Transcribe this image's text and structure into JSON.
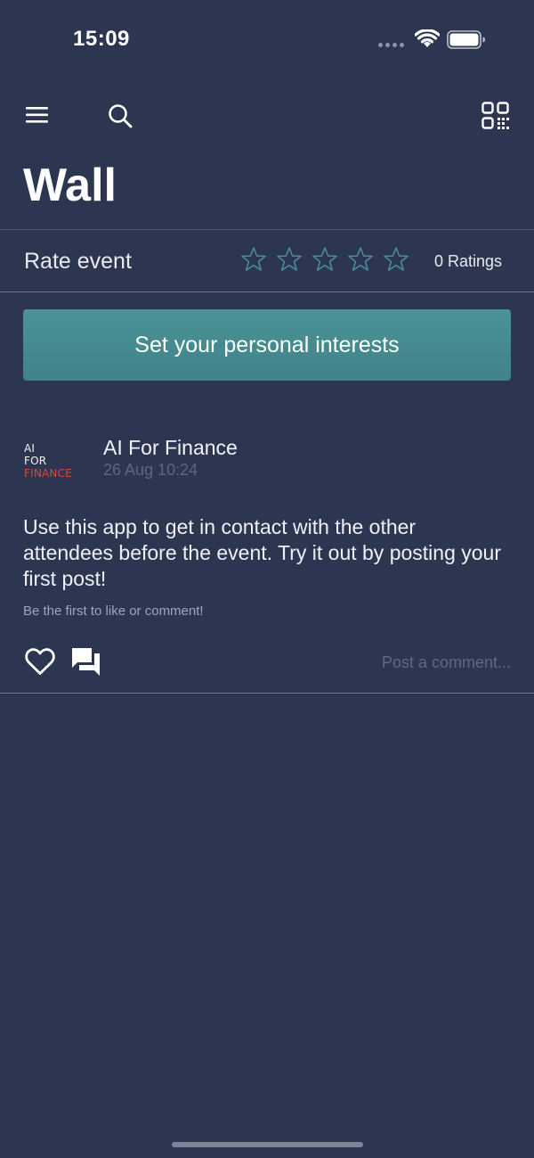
{
  "status_bar": {
    "time": "15:09"
  },
  "toolbar": {
    "menu_icon": "menu-icon",
    "search_icon": "search-icon",
    "qr_icon": "qr-code-icon"
  },
  "page": {
    "title": "Wall"
  },
  "rating": {
    "label": "Rate event",
    "stars_total": 5,
    "stars_filled": 0,
    "count_text": "0 Ratings"
  },
  "interests_button": {
    "label": "Set your personal interests"
  },
  "post": {
    "logo_lines": [
      "AI",
      "FOR",
      "FINANCE"
    ],
    "author": "AI For Finance",
    "timestamp": "26 Aug 10:24",
    "body": "Use this app to get in contact with the other attendees before the event. Try it out by posting your first post!",
    "hint": "Be the first to like or comment!",
    "comment_placeholder": "Post a comment..."
  },
  "colors": {
    "background": "#2d3651",
    "button": "#4a9296",
    "logo_accent": "#d9453b"
  }
}
